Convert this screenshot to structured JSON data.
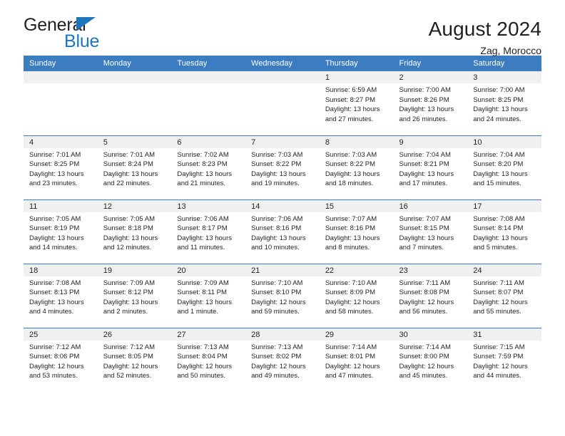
{
  "brand": {
    "name_top": "General",
    "name_bottom": "Blue",
    "accent_color": "#1b76bc"
  },
  "header": {
    "title": "August 2024",
    "subtitle": "Zag, Morocco"
  },
  "colors": {
    "header_row_bg": "#3b7dc0",
    "daynum_bg": "#f0f0f0",
    "text": "#231f20"
  },
  "weekday_headers": [
    "Sunday",
    "Monday",
    "Tuesday",
    "Wednesday",
    "Thursday",
    "Friday",
    "Saturday"
  ],
  "labels": {
    "sunrise": "Sunrise:",
    "sunset": "Sunset:",
    "daylight": "Daylight:"
  },
  "weeks": [
    [
      {
        "empty": true
      },
      {
        "empty": true
      },
      {
        "empty": true
      },
      {
        "empty": true
      },
      {
        "day": "1",
        "sunrise": "Sunrise: 6:59 AM",
        "sunset": "Sunset: 8:27 PM",
        "daylight1": "Daylight: 13 hours",
        "daylight2": "and 27 minutes."
      },
      {
        "day": "2",
        "sunrise": "Sunrise: 7:00 AM",
        "sunset": "Sunset: 8:26 PM",
        "daylight1": "Daylight: 13 hours",
        "daylight2": "and 26 minutes."
      },
      {
        "day": "3",
        "sunrise": "Sunrise: 7:00 AM",
        "sunset": "Sunset: 8:25 PM",
        "daylight1": "Daylight: 13 hours",
        "daylight2": "and 24 minutes."
      }
    ],
    [
      {
        "day": "4",
        "sunrise": "Sunrise: 7:01 AM",
        "sunset": "Sunset: 8:25 PM",
        "daylight1": "Daylight: 13 hours",
        "daylight2": "and 23 minutes."
      },
      {
        "day": "5",
        "sunrise": "Sunrise: 7:01 AM",
        "sunset": "Sunset: 8:24 PM",
        "daylight1": "Daylight: 13 hours",
        "daylight2": "and 22 minutes."
      },
      {
        "day": "6",
        "sunrise": "Sunrise: 7:02 AM",
        "sunset": "Sunset: 8:23 PM",
        "daylight1": "Daylight: 13 hours",
        "daylight2": "and 21 minutes."
      },
      {
        "day": "7",
        "sunrise": "Sunrise: 7:03 AM",
        "sunset": "Sunset: 8:22 PM",
        "daylight1": "Daylight: 13 hours",
        "daylight2": "and 19 minutes."
      },
      {
        "day": "8",
        "sunrise": "Sunrise: 7:03 AM",
        "sunset": "Sunset: 8:22 PM",
        "daylight1": "Daylight: 13 hours",
        "daylight2": "and 18 minutes."
      },
      {
        "day": "9",
        "sunrise": "Sunrise: 7:04 AM",
        "sunset": "Sunset: 8:21 PM",
        "daylight1": "Daylight: 13 hours",
        "daylight2": "and 17 minutes."
      },
      {
        "day": "10",
        "sunrise": "Sunrise: 7:04 AM",
        "sunset": "Sunset: 8:20 PM",
        "daylight1": "Daylight: 13 hours",
        "daylight2": "and 15 minutes."
      }
    ],
    [
      {
        "day": "11",
        "sunrise": "Sunrise: 7:05 AM",
        "sunset": "Sunset: 8:19 PM",
        "daylight1": "Daylight: 13 hours",
        "daylight2": "and 14 minutes."
      },
      {
        "day": "12",
        "sunrise": "Sunrise: 7:05 AM",
        "sunset": "Sunset: 8:18 PM",
        "daylight1": "Daylight: 13 hours",
        "daylight2": "and 12 minutes."
      },
      {
        "day": "13",
        "sunrise": "Sunrise: 7:06 AM",
        "sunset": "Sunset: 8:17 PM",
        "daylight1": "Daylight: 13 hours",
        "daylight2": "and 11 minutes."
      },
      {
        "day": "14",
        "sunrise": "Sunrise: 7:06 AM",
        "sunset": "Sunset: 8:16 PM",
        "daylight1": "Daylight: 13 hours",
        "daylight2": "and 10 minutes."
      },
      {
        "day": "15",
        "sunrise": "Sunrise: 7:07 AM",
        "sunset": "Sunset: 8:16 PM",
        "daylight1": "Daylight: 13 hours",
        "daylight2": "and 8 minutes."
      },
      {
        "day": "16",
        "sunrise": "Sunrise: 7:07 AM",
        "sunset": "Sunset: 8:15 PM",
        "daylight1": "Daylight: 13 hours",
        "daylight2": "and 7 minutes."
      },
      {
        "day": "17",
        "sunrise": "Sunrise: 7:08 AM",
        "sunset": "Sunset: 8:14 PM",
        "daylight1": "Daylight: 13 hours",
        "daylight2": "and 5 minutes."
      }
    ],
    [
      {
        "day": "18",
        "sunrise": "Sunrise: 7:08 AM",
        "sunset": "Sunset: 8:13 PM",
        "daylight1": "Daylight: 13 hours",
        "daylight2": "and 4 minutes."
      },
      {
        "day": "19",
        "sunrise": "Sunrise: 7:09 AM",
        "sunset": "Sunset: 8:12 PM",
        "daylight1": "Daylight: 13 hours",
        "daylight2": "and 2 minutes."
      },
      {
        "day": "20",
        "sunrise": "Sunrise: 7:09 AM",
        "sunset": "Sunset: 8:11 PM",
        "daylight1": "Daylight: 13 hours",
        "daylight2": "and 1 minute."
      },
      {
        "day": "21",
        "sunrise": "Sunrise: 7:10 AM",
        "sunset": "Sunset: 8:10 PM",
        "daylight1": "Daylight: 12 hours",
        "daylight2": "and 59 minutes."
      },
      {
        "day": "22",
        "sunrise": "Sunrise: 7:10 AM",
        "sunset": "Sunset: 8:09 PM",
        "daylight1": "Daylight: 12 hours",
        "daylight2": "and 58 minutes."
      },
      {
        "day": "23",
        "sunrise": "Sunrise: 7:11 AM",
        "sunset": "Sunset: 8:08 PM",
        "daylight1": "Daylight: 12 hours",
        "daylight2": "and 56 minutes."
      },
      {
        "day": "24",
        "sunrise": "Sunrise: 7:11 AM",
        "sunset": "Sunset: 8:07 PM",
        "daylight1": "Daylight: 12 hours",
        "daylight2": "and 55 minutes."
      }
    ],
    [
      {
        "day": "25",
        "sunrise": "Sunrise: 7:12 AM",
        "sunset": "Sunset: 8:06 PM",
        "daylight1": "Daylight: 12 hours",
        "daylight2": "and 53 minutes."
      },
      {
        "day": "26",
        "sunrise": "Sunrise: 7:12 AM",
        "sunset": "Sunset: 8:05 PM",
        "daylight1": "Daylight: 12 hours",
        "daylight2": "and 52 minutes."
      },
      {
        "day": "27",
        "sunrise": "Sunrise: 7:13 AM",
        "sunset": "Sunset: 8:04 PM",
        "daylight1": "Daylight: 12 hours",
        "daylight2": "and 50 minutes."
      },
      {
        "day": "28",
        "sunrise": "Sunrise: 7:13 AM",
        "sunset": "Sunset: 8:02 PM",
        "daylight1": "Daylight: 12 hours",
        "daylight2": "and 49 minutes."
      },
      {
        "day": "29",
        "sunrise": "Sunrise: 7:14 AM",
        "sunset": "Sunset: 8:01 PM",
        "daylight1": "Daylight: 12 hours",
        "daylight2": "and 47 minutes."
      },
      {
        "day": "30",
        "sunrise": "Sunrise: 7:14 AM",
        "sunset": "Sunset: 8:00 PM",
        "daylight1": "Daylight: 12 hours",
        "daylight2": "and 45 minutes."
      },
      {
        "day": "31",
        "sunrise": "Sunrise: 7:15 AM",
        "sunset": "Sunset: 7:59 PM",
        "daylight1": "Daylight: 12 hours",
        "daylight2": "and 44 minutes."
      }
    ]
  ]
}
